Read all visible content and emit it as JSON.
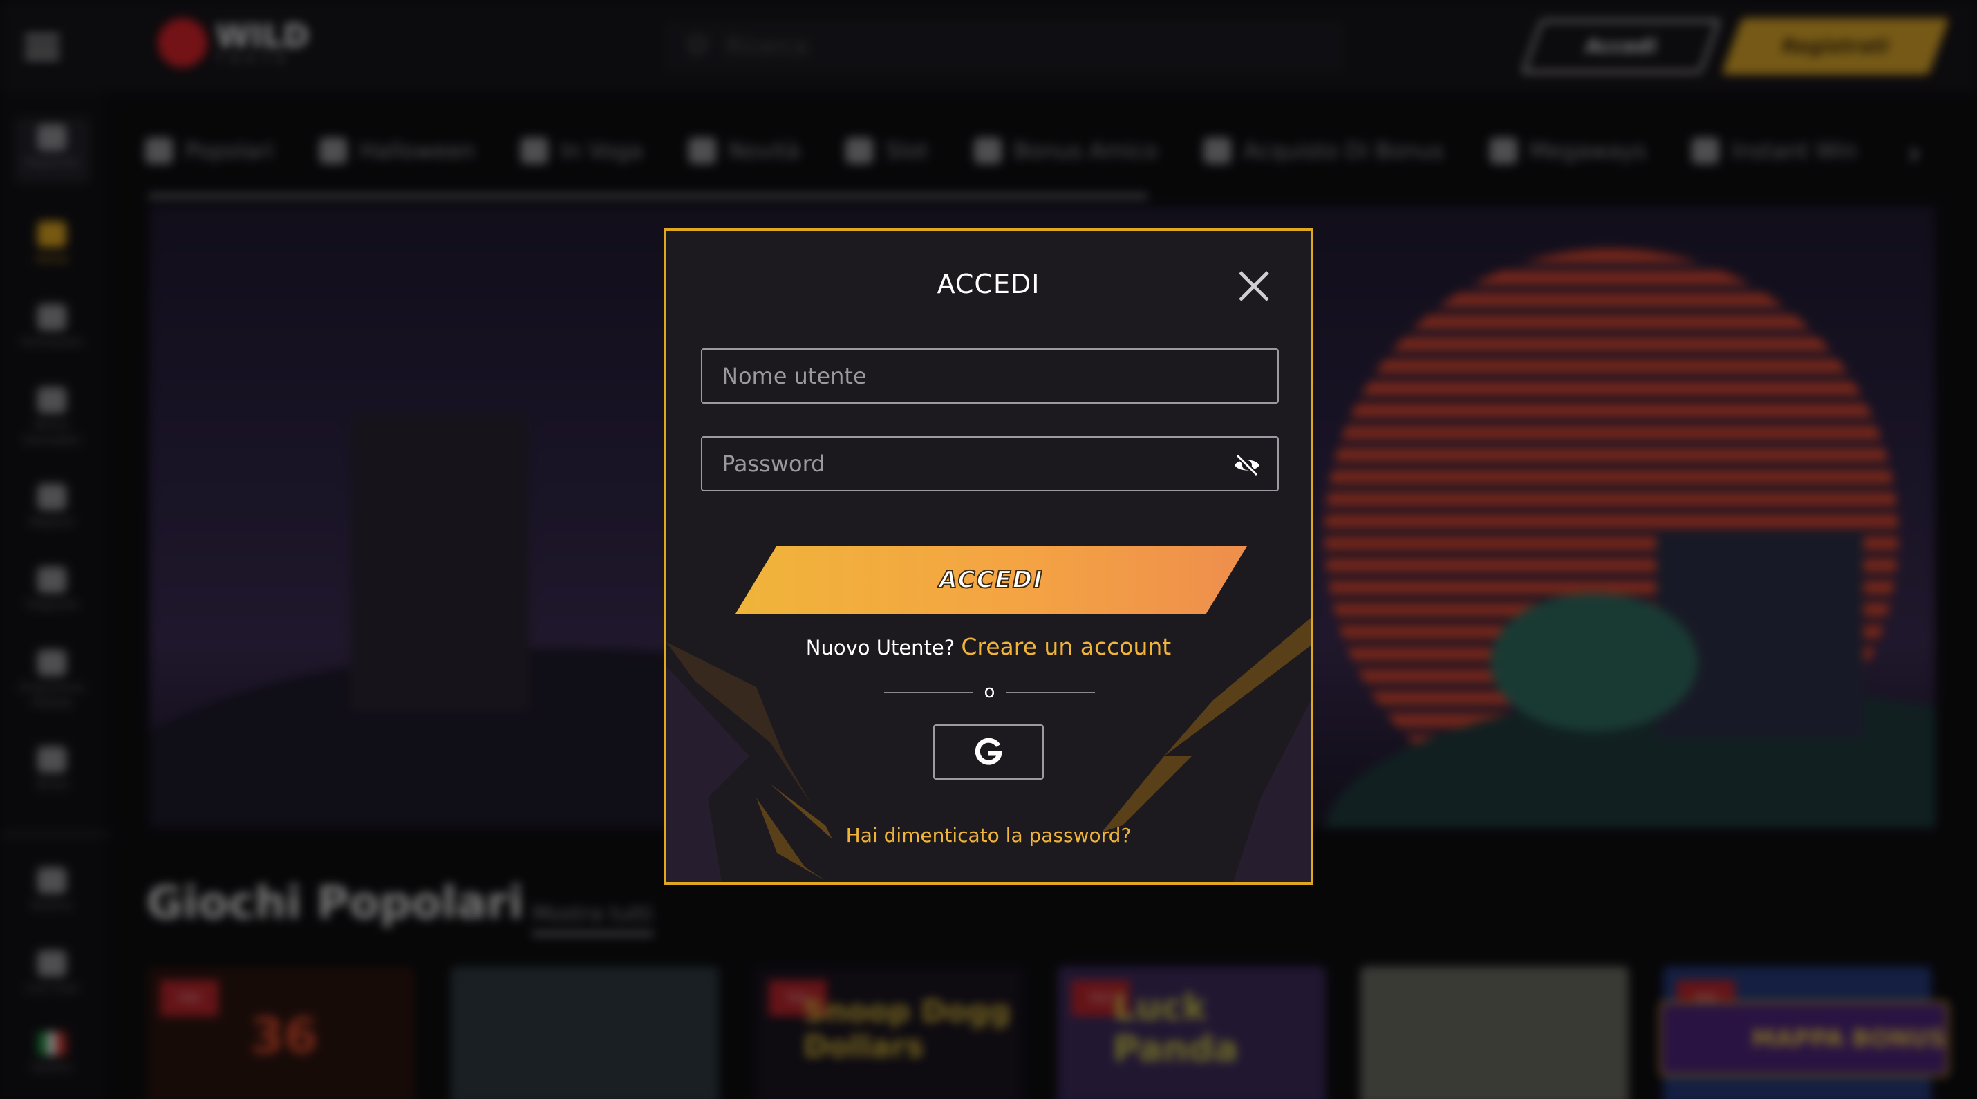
{
  "header": {
    "logo_text": "WILD",
    "logo_sub": "TOKYO",
    "search_placeholder": "Ricerca",
    "login_label": "Accedi",
    "register_label": "Registrati"
  },
  "sidebar": {
    "items": [
      {
        "label": "Registrati",
        "icon": "gear-icon"
      },
      {
        "label": "Home",
        "icon": "home-icon"
      },
      {
        "label": "Promozioni",
        "icon": "megaphone-icon"
      },
      {
        "label": "Bonus Giornalieri",
        "icon": "gift-icon"
      },
      {
        "label": "Negozio",
        "icon": "shop-icon"
      },
      {
        "label": "Traguardi",
        "icon": "milestone-icon"
      },
      {
        "label": "Programma Fedeltà",
        "icon": "crown-icon"
      },
      {
        "label": "Tornei",
        "icon": "trophy-icon"
      },
      {
        "label": "Ricerca",
        "icon": "search-icon"
      },
      {
        "label": "Live Chat",
        "icon": "chat-icon"
      },
      {
        "label": "Italiano",
        "icon": "flag-italy-icon"
      }
    ]
  },
  "categories": [
    {
      "label": "Popolari",
      "icon": "crown-icon"
    },
    {
      "label": "Halloween",
      "icon": "pumpkin-icon"
    },
    {
      "label": "In Voga",
      "icon": "fire-icon"
    },
    {
      "label": "Novità",
      "icon": "new-icon"
    },
    {
      "label": "Slot",
      "icon": "slot-icon"
    },
    {
      "label": "Bonus Amico",
      "icon": "gift-icon"
    },
    {
      "label": "Acquisto Di Bonus",
      "icon": "bonus-buy-icon"
    },
    {
      "label": "Megaways",
      "icon": "megaways-icon"
    },
    {
      "label": "Instant Win",
      "icon": "timer-icon"
    }
  ],
  "section": {
    "title": "Giochi Popolari",
    "show_all": "Mostra tutti"
  },
  "games": [
    {
      "title": "36",
      "badge": "Hot"
    },
    {
      "title": "",
      "badge": ""
    },
    {
      "title": "Snoop Dogg Dollars",
      "badge": "Hot"
    },
    {
      "title": "Luck Panda",
      "badge": "Hot"
    },
    {
      "title": "",
      "badge": ""
    },
    {
      "title": "",
      "badge": "Hot"
    }
  ],
  "bonus_map": "MAPPA BONUS",
  "modal": {
    "title": "ACCEDI",
    "username_placeholder": "Nome utente",
    "password_placeholder": "Password",
    "submit_label": "ACCEDI",
    "new_user_text": "Nuovo Utente?",
    "create_account_link": "Creare un account",
    "or_text": "o",
    "forgot_password": "Hai dimenticato la password?",
    "accent_color": "#f0b43a",
    "border_color": "#e0a81e"
  }
}
